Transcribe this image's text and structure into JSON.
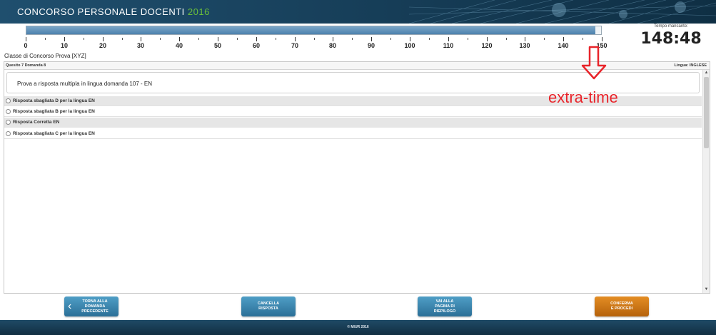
{
  "header": {
    "title": "CONCORSO PERSONALE DOCENTI",
    "year": "2016"
  },
  "progress": {
    "fraction": 0.99,
    "ticks": [
      "0",
      "10",
      "20",
      "30",
      "40",
      "50",
      "60",
      "70",
      "80",
      "90",
      "100",
      "110",
      "120",
      "130",
      "140",
      "150"
    ]
  },
  "timer": {
    "label": "Tempo mancante:",
    "value": "148:48"
  },
  "class_line": "Classe di Concorso Prova [XYZ]",
  "panel": {
    "question_number": "Quesito 7 Domanda 8",
    "language": "Lingua: INGLESE",
    "question_text": "Prova a risposta multipla in lingua domanda 107 - EN",
    "answers": [
      "Risposta sbagliata D per la lingua EN",
      "Risposta sbagliata B per la lingua EN",
      "Risposta Corretta EN",
      "Risposta sbagliata C per la lingua EN"
    ]
  },
  "annotation": {
    "text": "extra-time",
    "color": "#e8242a"
  },
  "buttons": {
    "back": "TORNA ALLA\nDOMANDA\nPRECEDENTE",
    "clear": "CANCELLA\nRISPOSTA",
    "summary": "VAI ALLA\nPAGINA DI\nRIEPILOGO",
    "confirm": "CONFERMA\nE PROCEDI"
  },
  "footer": "© MIUR 2016",
  "colors": {
    "header_bg": "#163d57",
    "accent_green": "#6bbf3a",
    "button_blue": "#2b6f97",
    "button_orange": "#b5620b"
  },
  "icons": {
    "back_chevron": "chevron-left-icon",
    "annotation_arrow": "arrow-down-icon"
  }
}
